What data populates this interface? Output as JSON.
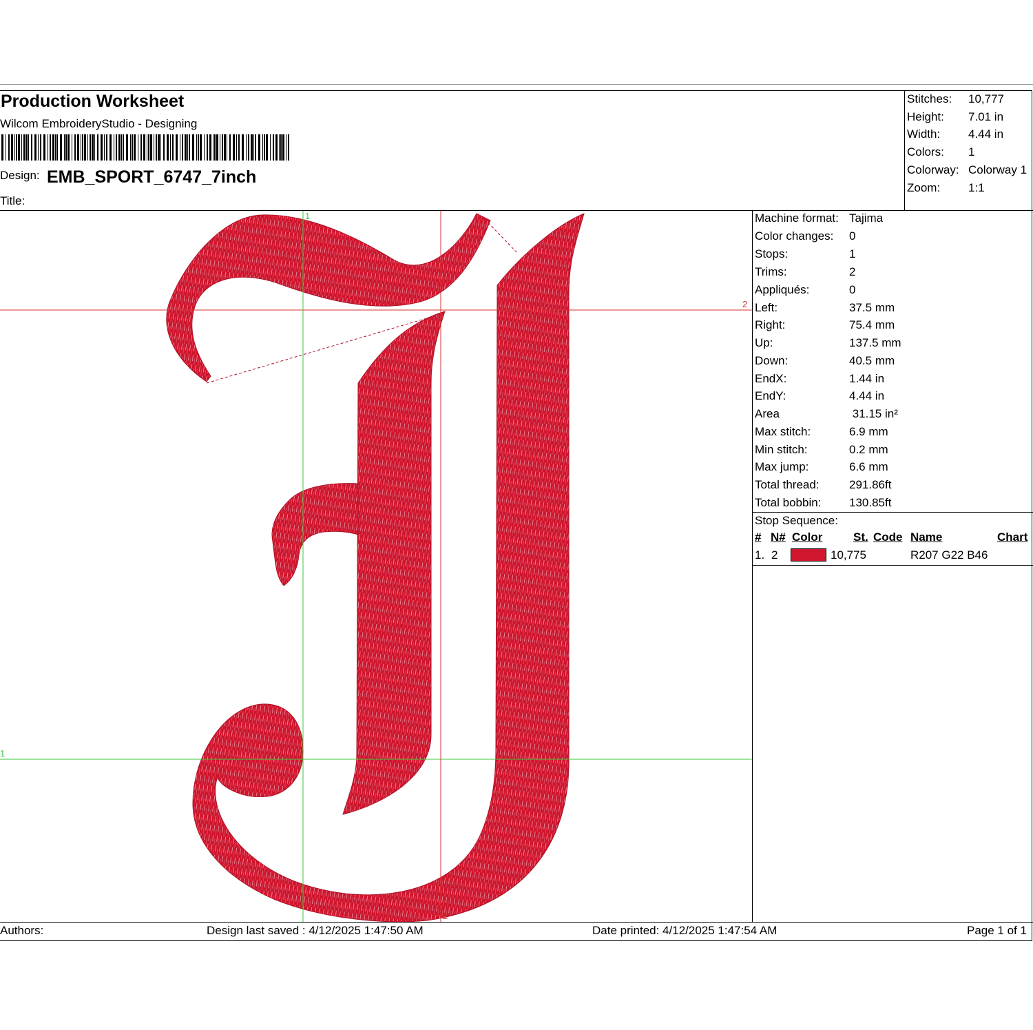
{
  "header": {
    "title": "Production Worksheet",
    "subtitle": "Wilcom EmbroideryStudio - Designing",
    "design_label": "Design:",
    "design_value": "EMB_SPORT_6747_7inch",
    "title_label": "Title:"
  },
  "stats": [
    {
      "label": "Stitches:",
      "value": "10,777"
    },
    {
      "label": "Height:",
      "value": "7.01 in"
    },
    {
      "label": "Width:",
      "value": "4.44 in"
    },
    {
      "label": "Colors:",
      "value": "1"
    },
    {
      "label": "Colorway:",
      "value": "Colorway 1"
    },
    {
      "label": "Zoom:",
      "value": "1:1"
    }
  ],
  "details": [
    {
      "label": "Machine format:",
      "value": "Tajima"
    },
    {
      "label": "Color changes:",
      "value": "0"
    },
    {
      "label": "Stops:",
      "value": "1"
    },
    {
      "label": "Trims:",
      "value": "2"
    },
    {
      "label": "Appliqués:",
      "value": "0"
    },
    {
      "label": "Left:",
      "value": "37.5 mm"
    },
    {
      "label": "Right:",
      "value": "75.4 mm"
    },
    {
      "label": "Up:",
      "value": "137.5 mm"
    },
    {
      "label": "Down:",
      "value": "40.5 mm"
    },
    {
      "label": "EndX:",
      "value": "1.44 in"
    },
    {
      "label": "EndY:",
      "value": "4.44 in"
    },
    {
      "label": "Area",
      "value": " 31.15 in²"
    },
    {
      "label": "Max stitch:",
      "value": "6.9 mm"
    },
    {
      "label": "Min stitch:",
      "value": "0.2 mm"
    },
    {
      "label": "Max jump:",
      "value": "6.6 mm"
    },
    {
      "label": "Total thread:",
      "value": "291.86ft"
    },
    {
      "label": "Total bobbin:",
      "value": "130.85ft"
    }
  ],
  "stop_sequence": {
    "label": "Stop Sequence:",
    "columns": [
      "#",
      "N#",
      "Color",
      "St.",
      "Code",
      "Name",
      "Chart"
    ],
    "rows": [
      {
        "index": "1.",
        "needle": "2",
        "color": "#cf162e",
        "stitches": "10,775",
        "code": "",
        "name": "R207 G22 B46",
        "chart": ""
      }
    ]
  },
  "guides": {
    "label_h_red": "2",
    "label_h_green": "1",
    "label_v_red": "2",
    "label_v_green": "1"
  },
  "footer": {
    "authors": "Authors:",
    "last_saved": "Design last saved : 4/12/2025 1:47:50 AM",
    "printed": "Date printed: 4/12/2025 1:47:54 AM",
    "page": "Page 1 of 1"
  },
  "colors": {
    "thread": "#cf162e",
    "guide_red": "#d83030",
    "guide_green": "#3cc83c"
  }
}
